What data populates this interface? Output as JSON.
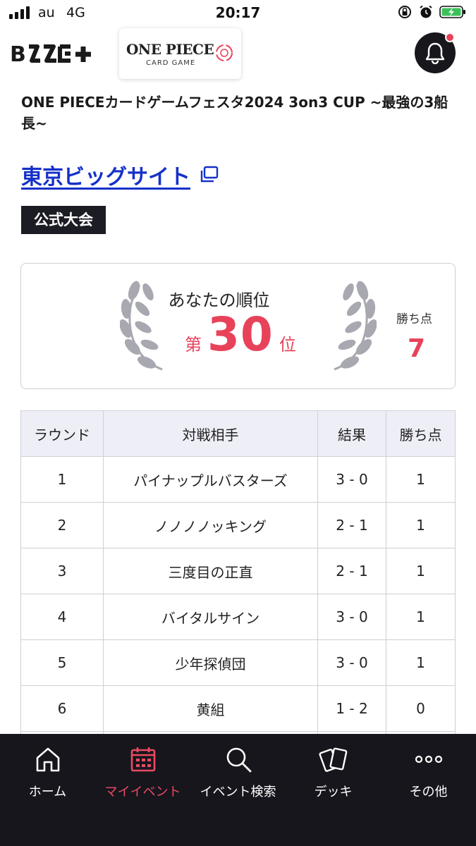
{
  "status_bar": {
    "carrier": "au",
    "network": "4G",
    "time": "20:17"
  },
  "header": {
    "brand": "BTCG+",
    "game_logo_title": "ONE PIECE",
    "game_logo_subtitle": "CARD GAME",
    "notification_badge": true
  },
  "event": {
    "title": "ONE PIECEカードゲームフェスタ2024 3on3 CUP ~最強の3船長~",
    "venue": "東京ビッグサイト",
    "category_tag": "公式大会"
  },
  "rank_card": {
    "label": "あなたの順位",
    "prefix": "第",
    "rank": "30",
    "suffix": "位",
    "points_label": "勝ち点",
    "points": "7"
  },
  "results_table": {
    "headers": [
      "ラウンド",
      "対戦相手",
      "結果",
      "勝ち点"
    ],
    "rows": [
      {
        "round": "1",
        "opponent": "パイナップルバスターズ",
        "result": "3 - 0",
        "points": "1"
      },
      {
        "round": "2",
        "opponent": "ノノノノッキング",
        "result": "2 - 1",
        "points": "1"
      },
      {
        "round": "3",
        "opponent": "三度目の正直",
        "result": "2 - 1",
        "points": "1"
      },
      {
        "round": "4",
        "opponent": "バイタルサイン",
        "result": "3 - 0",
        "points": "1"
      },
      {
        "round": "5",
        "opponent": "少年探偵団",
        "result": "3 - 0",
        "points": "1"
      },
      {
        "round": "6",
        "opponent": "黄組",
        "result": "1 - 2",
        "points": "0"
      }
    ]
  },
  "bottom_nav": {
    "items": [
      {
        "label": "ホーム",
        "icon": "home-icon",
        "active": false
      },
      {
        "label": "マイイベント",
        "icon": "calendar-icon",
        "active": true
      },
      {
        "label": "イベント検索",
        "icon": "search-icon",
        "active": false
      },
      {
        "label": "デッキ",
        "icon": "cards-icon",
        "active": false
      },
      {
        "label": "その他",
        "icon": "more-icon",
        "active": false
      }
    ]
  },
  "colors": {
    "accent": "#e8425a",
    "link": "#1531c9",
    "nav_background": "#16161c",
    "table_header": "#eeeef7",
    "tag_background": "#1c1c24"
  }
}
